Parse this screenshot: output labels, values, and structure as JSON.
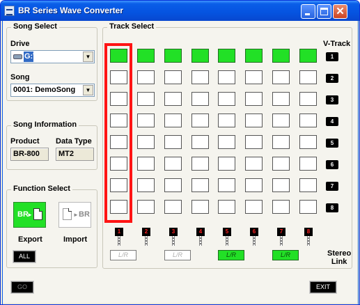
{
  "window": {
    "title": "BR Series Wave Converter",
    "minimize_glyph": "",
    "maximize_glyph": "",
    "close_glyph": "✕"
  },
  "song_select": {
    "group_title": "Song Select",
    "drive_label": "Drive",
    "drive_value": "G:\\",
    "song_label": "Song",
    "song_value": "0001: DemoSong"
  },
  "song_information": {
    "group_title": "Song Information",
    "product_label": "Product",
    "product_value": "BR-800",
    "data_type_label": "Data Type",
    "data_type_value": "MT2"
  },
  "function_select": {
    "group_title": "Function Select",
    "export_button_text": "BR",
    "export_arrow": "►",
    "import_arrow": "►",
    "import_button_text": "BR",
    "export_label": "Export",
    "import_label": "Import",
    "all_button": "ALL"
  },
  "track_select": {
    "group_title": "Track Select",
    "vtrack_label": "V-Track",
    "vtrack_numbers": [
      "1",
      "2",
      "3",
      "4",
      "5",
      "6",
      "7",
      "8"
    ],
    "channel_numbers": [
      "1",
      "2",
      "3",
      "4",
      "5",
      "6",
      "7",
      "8"
    ],
    "lr_label": "L/R",
    "stereo_link_label_line1": "Stereo",
    "stereo_link_label_line2": "Link",
    "active_row": 1,
    "stereo_link_states": [
      "off",
      "off",
      "on",
      "on"
    ]
  },
  "bottom": {
    "go_button": "GO",
    "exit_button": "EXIT"
  },
  "colors": {
    "titlebar": "#0553e0",
    "active_green": "#22e026",
    "highlight_red": "#ff1414",
    "panel_bg": "#f5f4ee"
  },
  "icons": {
    "app": "wave-converter-icon",
    "drive": "drive-icon",
    "document": "document-icon"
  }
}
